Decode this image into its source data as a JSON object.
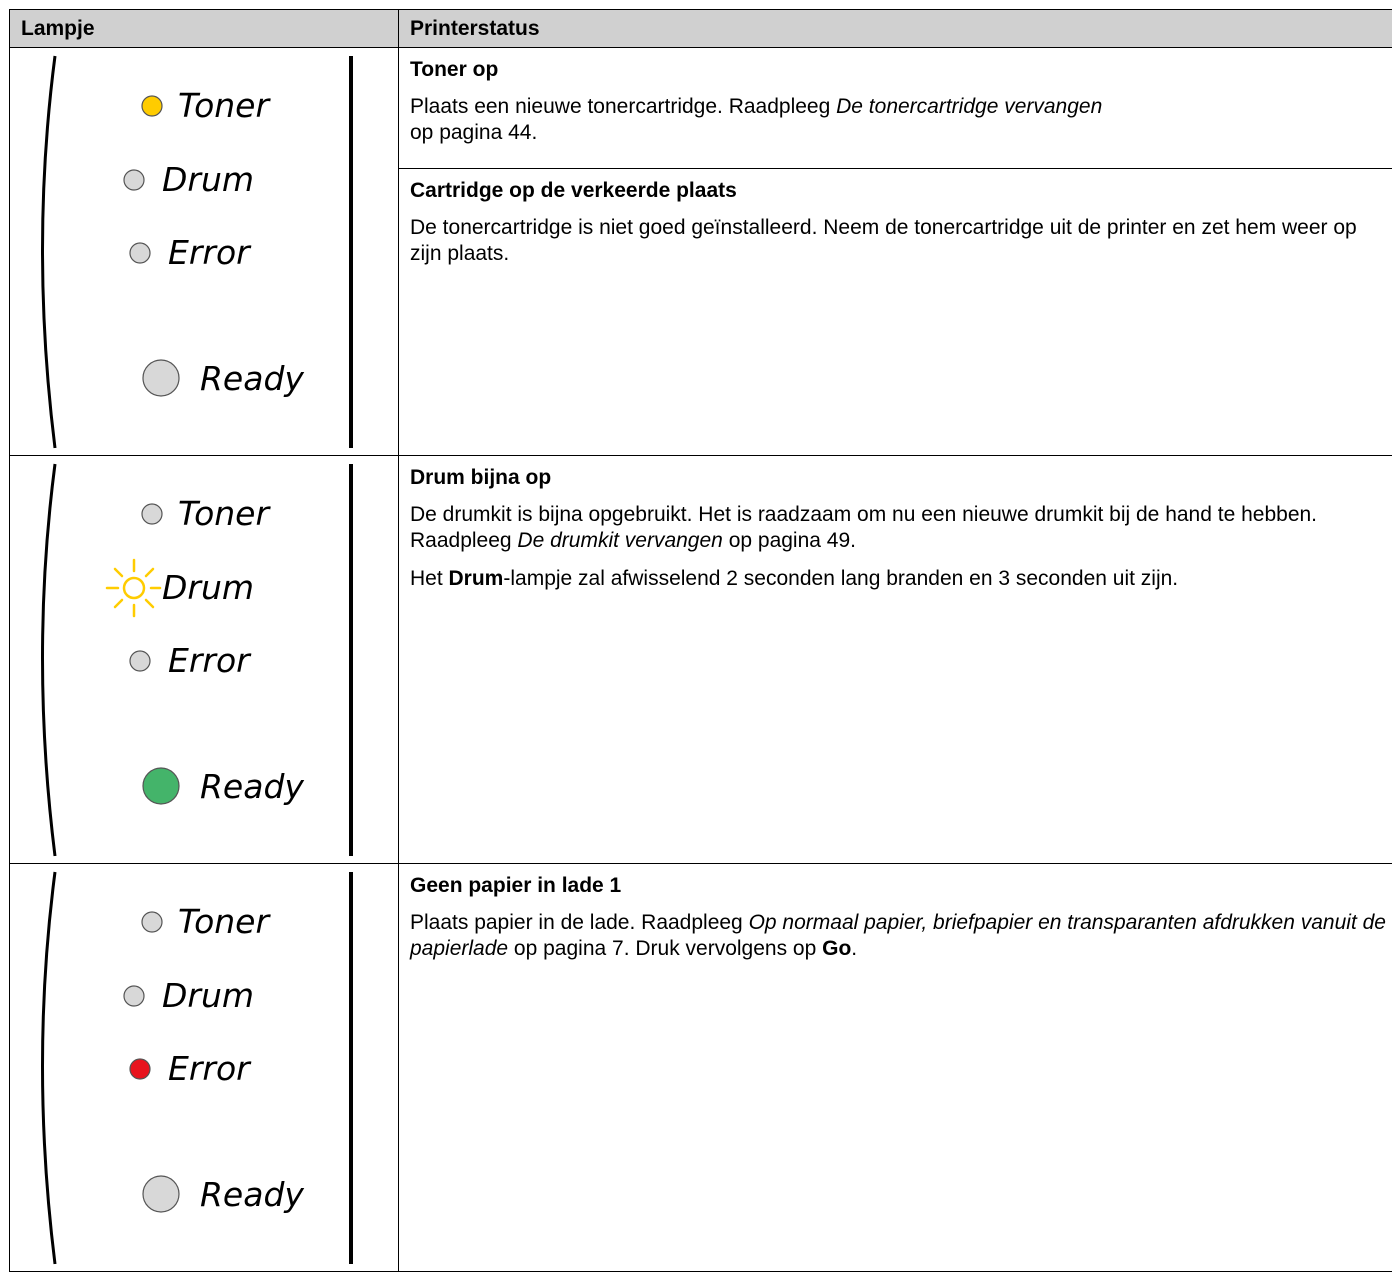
{
  "header": {
    "col_lamp": "Lampje",
    "col_status": "Printerstatus"
  },
  "lamp_labels": {
    "toner": "Toner",
    "drum": "Drum",
    "error": "Error",
    "ready": "Ready"
  },
  "colors": {
    "off": "#d8d8d8",
    "yellow": "#ffcc00",
    "green": "#44b46a",
    "red": "#e8141e",
    "header_bg": "#d0d0d0"
  },
  "rows": [
    {
      "lamps": {
        "toner": "on-yellow",
        "drum": "off",
        "error": "off",
        "ready": "off"
      },
      "statuses": [
        {
          "title": "Toner op",
          "text_a": "Plaats een nieuwe tonercartridge. Raadpleeg ",
          "text_italic": "De tonercartridge vervangen",
          "text_b": " op pagina 44."
        },
        {
          "title": "Cartridge op de verkeerde plaats",
          "text": "De tonercartridge is niet goed geïnstalleerd. Neem de tonercartridge uit de printer en zet hem weer op zijn plaats."
        }
      ]
    },
    {
      "lamps": {
        "toner": "off",
        "drum": "blinking-yellow",
        "error": "off",
        "ready": "on-green"
      },
      "statuses": [
        {
          "title": "Drum bijna op",
          "text_a": "De drumkit is bijna opgebruikt. Het is raadzaam om nu een nieuwe drumkit bij de hand te hebben. Raadpleeg ",
          "text_italic": "De drumkit vervangen",
          "text_b": " op pagina 49.",
          "note_a": "Het ",
          "note_bold": "Drum",
          "note_b": "-lampje zal afwisselend 2 seconden lang branden en 3 seconden uit zijn."
        }
      ]
    },
    {
      "lamps": {
        "toner": "off",
        "drum": "off",
        "error": "on-red",
        "ready": "off"
      },
      "statuses": [
        {
          "title": "Geen papier in lade 1",
          "text_a": "Plaats papier in de lade. Raadpleeg ",
          "text_italic": "Op normaal papier, briefpapier en transparanten afdrukken vanuit de papierlade",
          "text_b": " op pagina 7. Druk vervolgens op ",
          "text_bold": "Go",
          "text_c": "."
        }
      ]
    }
  ]
}
